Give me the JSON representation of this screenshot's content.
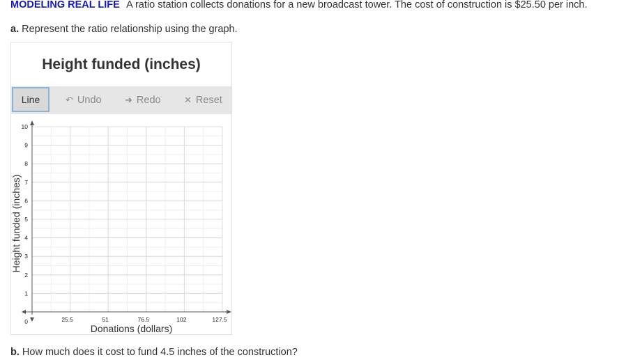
{
  "problem": {
    "tag": "MODELING REAL LIFE",
    "text": "A ratio station collects donations for a new broadcast tower. The cost of construction is $25.50 per inch."
  },
  "part_a": {
    "label": "a.",
    "text": "Represent the ratio relationship using the graph."
  },
  "part_b": {
    "label": "b.",
    "text": "How much does it cost to fund 4.5 inches of the construction?"
  },
  "graph_widget": {
    "title": "Height funded (inches)",
    "toolbar": {
      "line": "Line",
      "undo": "Undo",
      "redo": "Redo",
      "reset": "Reset"
    },
    "icons": {
      "undo": "undo-arrow-icon",
      "redo": "redo-arrow-icon",
      "reset": "x-icon"
    }
  },
  "chart_data": {
    "type": "scatter",
    "title": "Height funded (inches)",
    "xlabel": "Donations (dollars)",
    "ylabel": "Height funded (inches)",
    "xlim": [
      0,
      127.5
    ],
    "ylim": [
      0,
      10
    ],
    "x_ticks": [
      25.5,
      51,
      76.5,
      102,
      127.5
    ],
    "y_ticks": [
      1,
      2,
      3,
      4,
      5,
      6,
      7,
      8,
      9,
      10
    ],
    "origin_label": "0",
    "x_minor_step": 12.75,
    "y_minor_step": 0.5,
    "grid": true,
    "series": []
  }
}
